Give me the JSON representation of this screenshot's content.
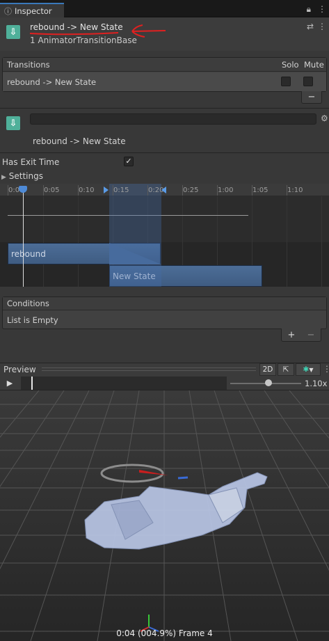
{
  "tab": {
    "title": "Inspector",
    "icon": "info-icon"
  },
  "header": {
    "title": "rebound -> New State",
    "subtitle": "1 AnimatorTransitionBase"
  },
  "transitions": {
    "header": "Transitions",
    "solo_label": "Solo",
    "mute_label": "Mute",
    "rows": [
      {
        "label": "rebound -> New State",
        "solo": false,
        "mute": false
      }
    ],
    "remove_label": "−"
  },
  "transition": {
    "name_value": "",
    "label": "rebound -> New State",
    "has_exit_time_label": "Has Exit Time",
    "has_exit_time": true,
    "settings_label": "Settings"
  },
  "timeline": {
    "ticks": [
      "0:00",
      "0:05",
      "0:10",
      "0:15",
      "0:20",
      "0:25",
      "1:00",
      "1:05",
      "1:10"
    ],
    "source_state": "rebound",
    "dest_state": "New State"
  },
  "conditions": {
    "header": "Conditions",
    "empty_text": "List is Empty",
    "add_label": "+",
    "remove_label": "−"
  },
  "preview": {
    "label": "Preview",
    "mode_2d": "2D",
    "speed": "1.10x",
    "frame": "0:04 (004.9%) Frame 4"
  },
  "colors": {
    "accent": "#3a79bb",
    "state_bar": "#4a6a94",
    "annotation": "#e02020"
  }
}
